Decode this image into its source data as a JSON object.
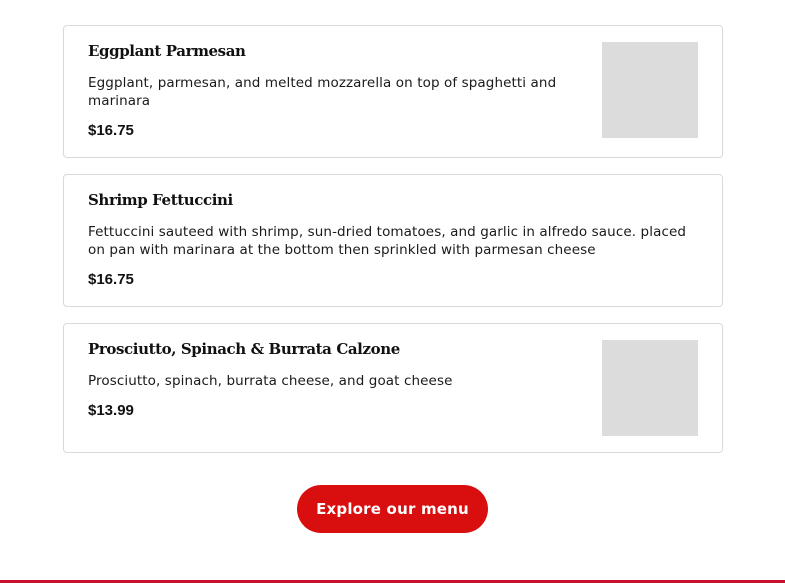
{
  "menu_items": [
    {
      "name": "Eggplant Parmesan",
      "description": "Eggplant, parmesan, and melted mozzarella on top of spaghetti and marinara",
      "price": "$16.75",
      "has_image": true
    },
    {
      "name": "Shrimp Fettuccini",
      "description": "Fettuccini sauteed with shrimp, sun-dried tomatoes, and garlic in alfredo sauce. placed on pan with marinara at the bottom then sprinkled with parmesan cheese",
      "price": "$16.75",
      "has_image": false
    },
    {
      "name": "Prosciutto, Spinach & Burrata Calzone",
      "description": "Prosciutto, spinach, burrata cheese, and goat cheese",
      "price": "$13.99",
      "has_image": true
    }
  ],
  "cta": {
    "label": "Explore our menu"
  },
  "colors": {
    "accent": "#d90f0f",
    "placeholder": "#dcdcdc",
    "border": "#d9d9d9"
  }
}
